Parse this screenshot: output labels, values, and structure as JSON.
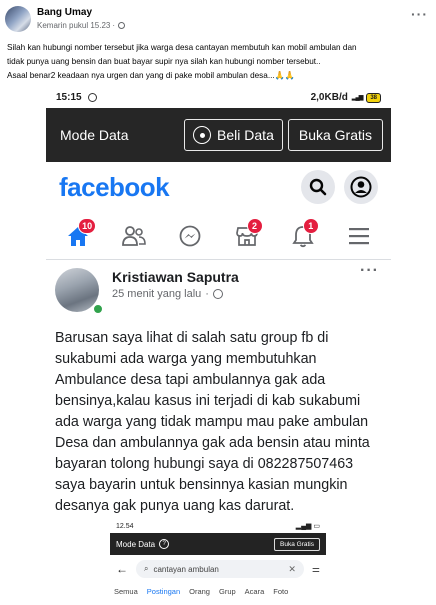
{
  "post": {
    "author": "Bang Umay",
    "timestamp": "Kemarin pukul 15.23",
    "separator": "·",
    "more": "···",
    "caption_line1": "Silah kan hubungi nomber tersebut jika warga desa cantayan membutuh kan mobil ambulan dan",
    "caption_line2": "tidak punya uang bensin dan buat bayar supir nya silah kan hubungi nomber tersebut..",
    "caption_line3": "Asaal benar2 keadaan nya urgen dan yang di pake mobil ambulan desa...🙏🙏"
  },
  "screenshot": {
    "status_bar": {
      "time": "15:15",
      "network": "2,0KB/d",
      "battery": "38"
    },
    "mode_bar": {
      "title": "Mode Data",
      "buy_label": "Beli Data",
      "free_label": "Buka Gratis"
    },
    "fb_logo": "facebook",
    "nav_badges": {
      "home": "10",
      "marketplace": "2",
      "notifications": "1"
    },
    "inner_post": {
      "name": "Kristiawan Saputra",
      "time": "25 menit yang lalu",
      "separator": "·",
      "more": "···",
      "body": "Barusan saya lihat di salah satu group fb di sukabumi ada warga yang membutuhkan Ambulance desa tapi ambulannya gak ada bensinya,kalau kasus ini terjadi di kab sukabumi ada warga yang tidak mampu mau pake ambulan Desa dan ambulannya gak ada bensin atau minta bayaran tolong hubungi saya di 082287507463 saya bayarin untuk bensinnya kasian mungkin desanya gak punya uang kas darurat."
    },
    "nested_shot": {
      "time": "12.54",
      "mode_title": "Mode Data",
      "mode_help": "?",
      "free_label": "Buka Gratis",
      "search_query": "cantayan ambulan",
      "tabs": [
        "Semua",
        "Postingan",
        "Orang",
        "Grup",
        "Acara",
        "Foto"
      ]
    }
  },
  "colors": {
    "fb_blue": "#1877f2",
    "badge_red": "#e41e3f",
    "online_green": "#31a24c",
    "mode_bar": "#262626"
  }
}
